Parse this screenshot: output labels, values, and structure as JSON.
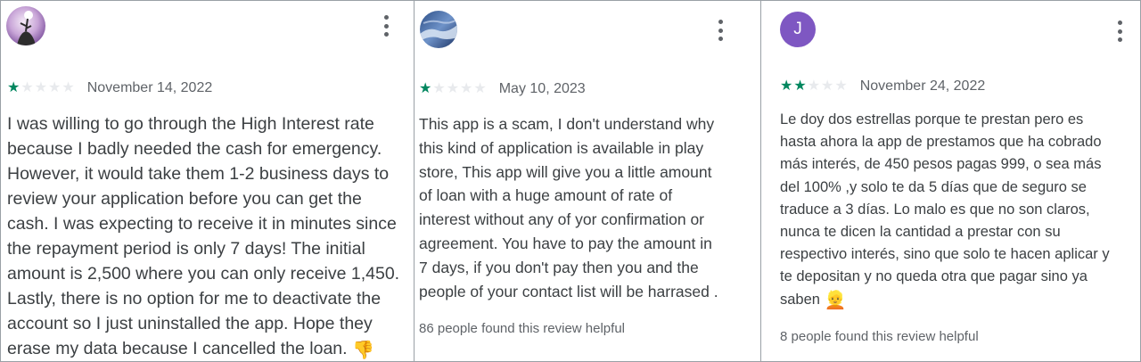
{
  "reviews": [
    {
      "avatar_icon": "flower-photo-icon",
      "rating": 1,
      "max_rating": 5,
      "date": "November 14, 2022",
      "text_lines": [
        "I was willing to go through the High Interest rate",
        "because I badly needed the cash for emergency.",
        "However, it would take them 1-2 business days to",
        "review your application before you can get the",
        "cash. I was expecting to receive it in minutes since",
        "the repayment period is only 7 days! The initial",
        "amount is 2,500 where you can only receive 1,450.",
        "Lastly, there is no option for me to deactivate the",
        "account so I just uninstalled the app. Hope they",
        "erase my data because I cancelled the loan. "
      ],
      "emoji": "👎",
      "helpful": ""
    },
    {
      "avatar_icon": "sky-photo-icon",
      "rating": 1,
      "max_rating": 5,
      "date": "May 10, 2023",
      "text_lines": [
        "This app is a scam, I don't understand why",
        "this kind of application is available in play",
        "store, This app will give you a little amount",
        "of loan with a huge amount of rate of",
        "interest without any of yor confirmation or",
        "agreement. You have to pay the amount in",
        "7 days, if you don't pay then you and the",
        "people of your contact list will be harrased ."
      ],
      "emoji": "",
      "helpful": "86 people found this review helpful"
    },
    {
      "avatar_letter": "J",
      "avatar_color": "#7e57c2",
      "rating": 2,
      "max_rating": 5,
      "date": "November 24, 2022",
      "text_lines": [
        "Le doy dos estrellas porque te prestan pero es",
        "hasta ahora la app de prestamos que ha cobrado",
        "más interés, de 450 pesos pagas 999, o sea más",
        "del 100% ,y solo te da 5 días que de seguro se",
        "traduce a 3 días. Lo malo es que no son claros,",
        "nunca te dicen la cantidad a prestar con su",
        "respectivo interés, sino que solo te hacen aplicar y",
        "te depositan y no queda otra que pagar sino ya",
        "saben "
      ],
      "emoji": "👱",
      "helpful": "8 people found this review helpful"
    }
  ],
  "colors": {
    "star_filled": "#01875f",
    "star_empty": "#e8eaed",
    "text": "#3c4043",
    "muted": "#5f6368"
  }
}
